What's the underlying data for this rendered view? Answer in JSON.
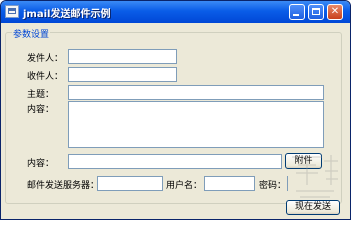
{
  "window": {
    "title": "jmail发送邮件示例"
  },
  "group": {
    "title": "参数设置"
  },
  "fields": {
    "sender_label": "发件人：",
    "recipient_label": "收件人：",
    "subject_label": "主题：",
    "content_label": "内容：",
    "attachment_label": "内容：",
    "smtp_label": "邮件发送服务器：",
    "username_label": "用户名：",
    "password_label": "密码："
  },
  "buttons": {
    "attach": "附件",
    "send": "现在发送"
  }
}
